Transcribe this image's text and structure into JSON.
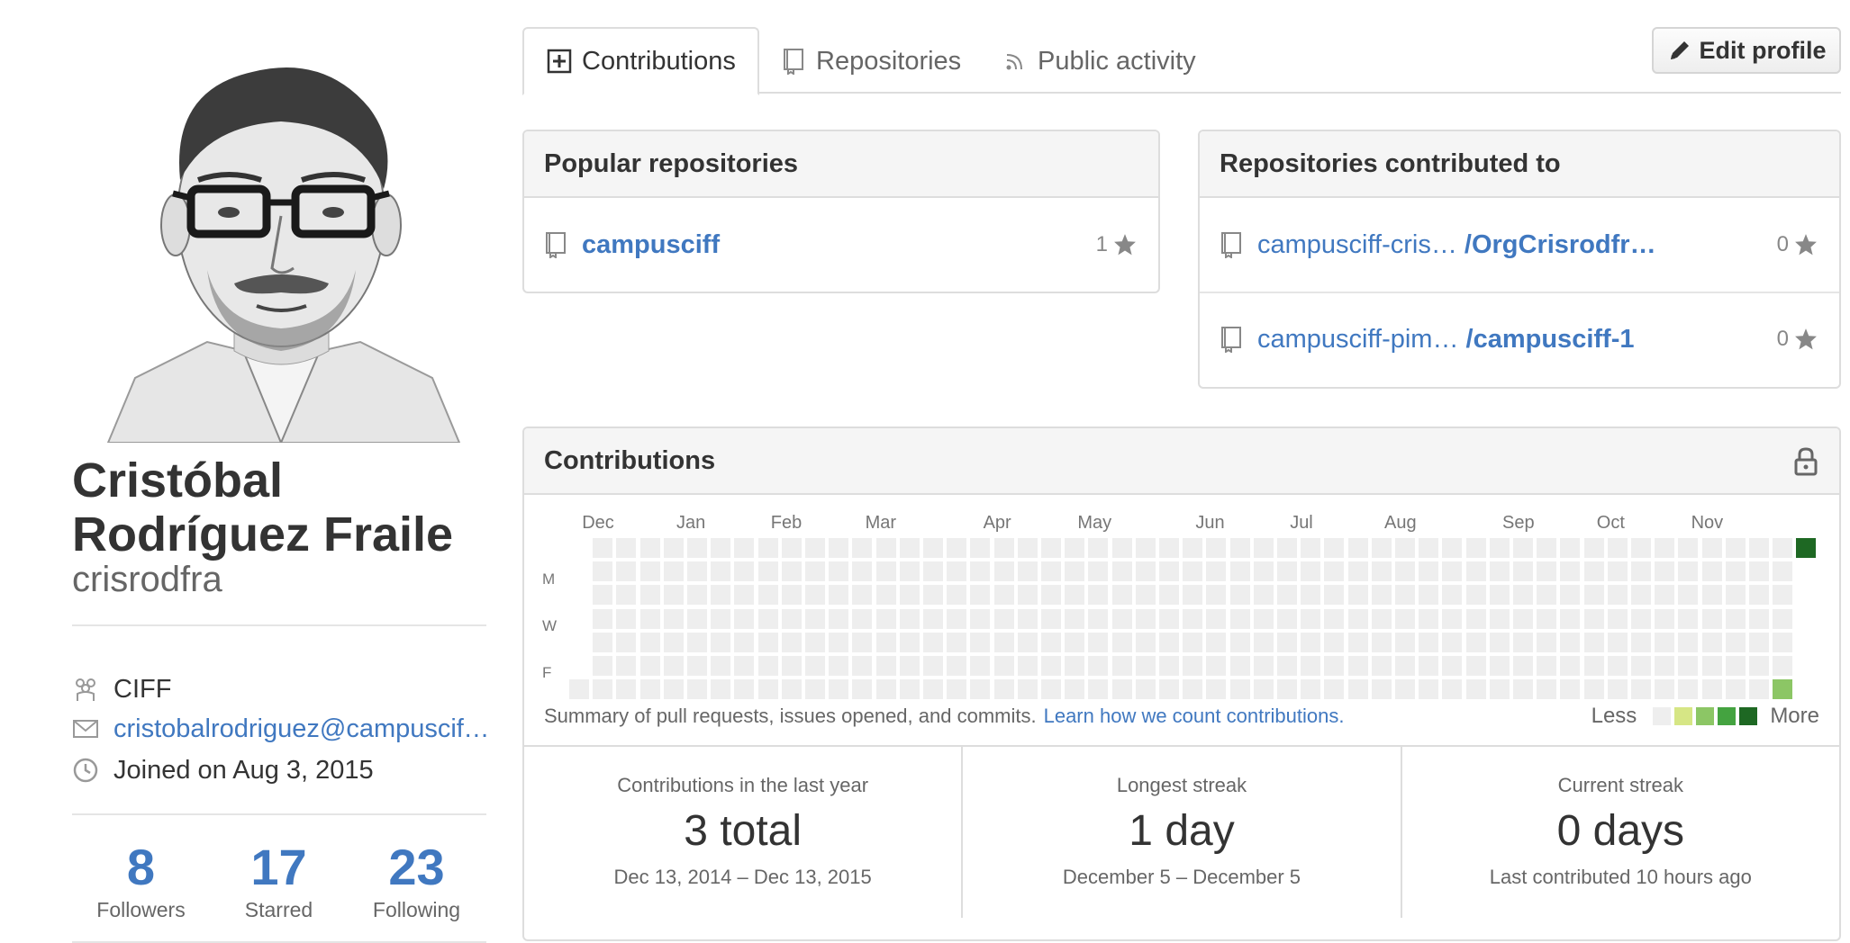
{
  "profile": {
    "full_name_line1": "Cristóbal",
    "full_name_line2": "Rodríguez Fraile",
    "username": "crisrodfra",
    "organization": "CIFF",
    "email": "cristobalrodriguez@campusciff…",
    "joined": "Joined on Aug 3, 2015",
    "stats": [
      {
        "value": "8",
        "label": "Followers"
      },
      {
        "value": "17",
        "label": "Starred"
      },
      {
        "value": "23",
        "label": "Following"
      }
    ]
  },
  "tabs": [
    {
      "label": "Contributions",
      "icon": "plus-box-icon",
      "selected": true
    },
    {
      "label": "Repositories",
      "icon": "repo-icon",
      "selected": false
    },
    {
      "label": "Public activity",
      "icon": "rss-icon",
      "selected": false
    }
  ],
  "edit_profile_label": "Edit profile",
  "popular": {
    "title": "Popular repositories",
    "repos": [
      {
        "name": "campusciff",
        "stars": "1"
      }
    ]
  },
  "contributed": {
    "title": "Repositories contributed to",
    "repos": [
      {
        "owner": "campusciff-cris…",
        "name": "/OrgCrisrodfr…",
        "stars": "0"
      },
      {
        "owner": "campusciff-pim…",
        "name": "/campusciff-1",
        "stars": "0"
      }
    ]
  },
  "contributions": {
    "title": "Contributions",
    "months": [
      "Dec",
      "Jan",
      "Feb",
      "Mar",
      "Apr",
      "May",
      "Jun",
      "Jul",
      "Aug",
      "Sep",
      "Oct",
      "Nov"
    ],
    "day_labels": [
      "M",
      "W",
      "F"
    ],
    "active_days": [
      {
        "week": 52,
        "day": 0,
        "level": 4
      },
      {
        "week": 51,
        "day": 6,
        "level": 2
      }
    ],
    "colors": {
      "empty": "#eeeeee",
      "level1": "#d6e685",
      "level2": "#8cc665",
      "level3": "#44a340",
      "level4": "#1e6823"
    },
    "summary": "Summary of pull requests, issues opened, and commits.",
    "learn_link": "Learn how we count contributions.",
    "legend_less": "Less",
    "legend_more": "More",
    "stats": [
      {
        "label": "Contributions in the last year",
        "value": "3 total",
        "sub": "Dec 13, 2014 – Dec 13, 2015"
      },
      {
        "label": "Longest streak",
        "value": "1 day",
        "sub": "December 5 – December 5"
      },
      {
        "label": "Current streak",
        "value": "0 days",
        "sub": "Last contributed 10 hours ago"
      }
    ]
  }
}
